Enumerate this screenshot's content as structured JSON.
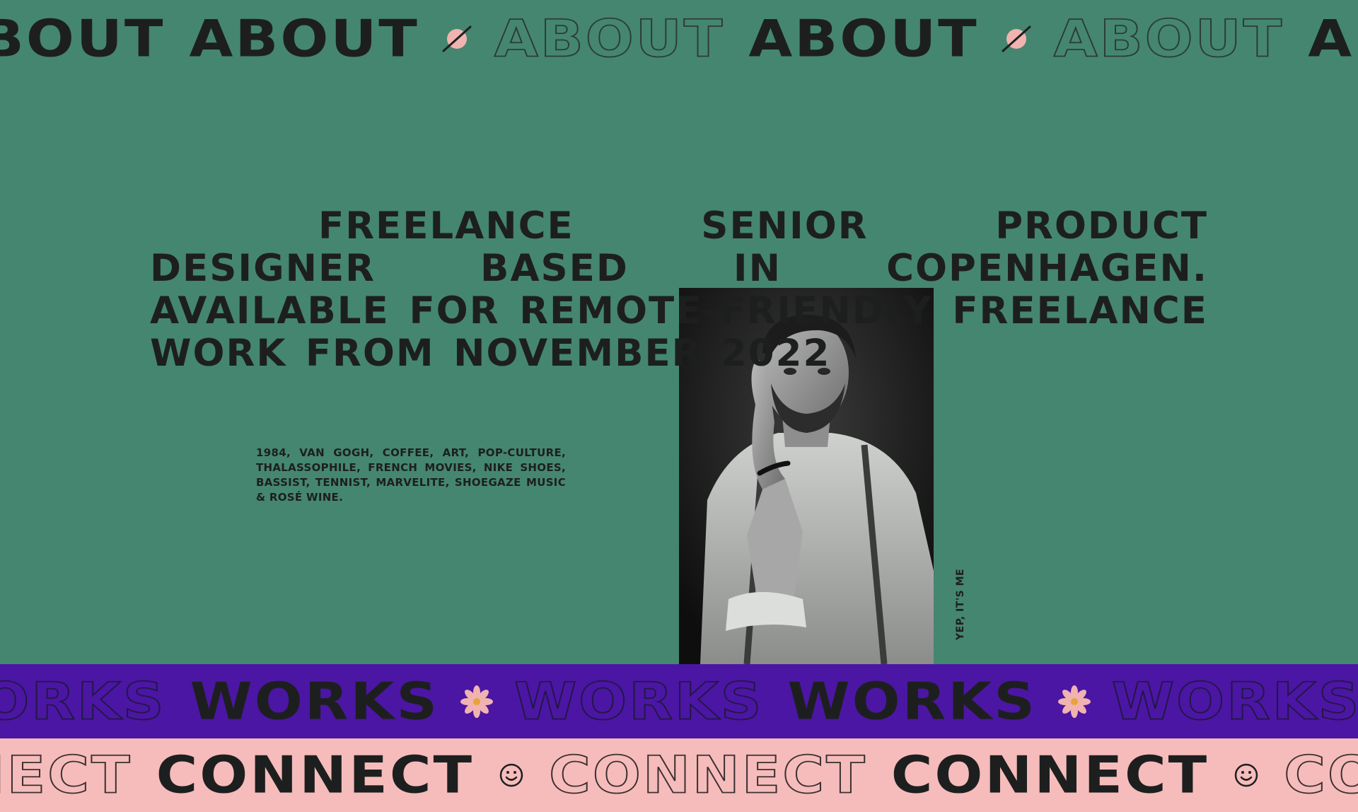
{
  "colors": {
    "about_band": "#458670",
    "works_band": "#4b16a3",
    "connect_band": "#f5bcbb",
    "ink": "#1d1f1f",
    "accent_pink": "#f0b3b0"
  },
  "about_band": {
    "word": "About",
    "icon": "planet-icon"
  },
  "works_band": {
    "word": "Works",
    "icon": "flower-icon"
  },
  "connect_band": {
    "word": "Connect",
    "icon": "smiley-icon"
  },
  "intro": {
    "headline": "Freelance senior product designer based in Copenhagen. Available for remote-friendly freelance work from November 2022",
    "bio": "1984, Van Gogh, Coffee, Art, Pop-culture, Thalassophile, French movies, Nike shoes, Bassist, Tennist, Marvelite, Shoegaze music & Rosé wine.",
    "portrait_caption": "Yep, it's me"
  }
}
